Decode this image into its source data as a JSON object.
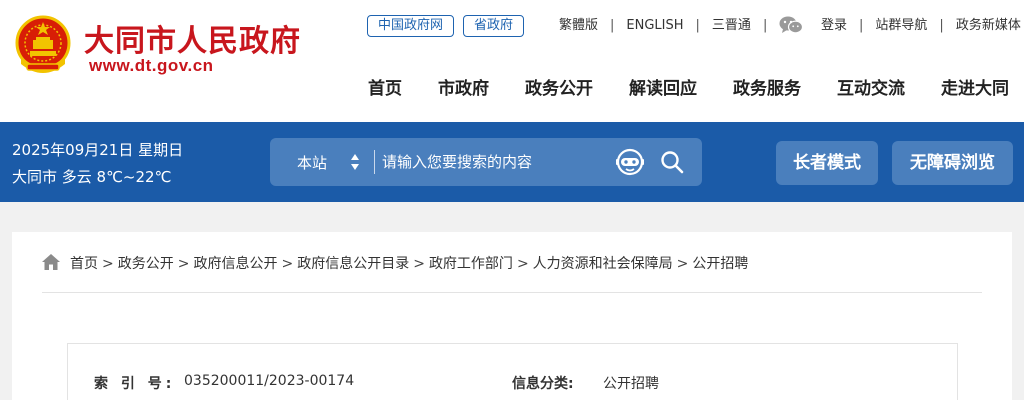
{
  "header": {
    "site_title": "大同市人民政府",
    "site_url": "www.dt.gov.cn",
    "portal_links": [
      "中国政府网",
      "省政府"
    ],
    "top_links_left": [
      "繁體版",
      "ENGLISH",
      "三晋通"
    ],
    "wechat_icon": "wechat-icon",
    "top_links_right": [
      "登录",
      "站群导航",
      "政务新媒体"
    ],
    "nav": [
      "首页",
      "市政府",
      "政务公开",
      "解读回应",
      "政务服务",
      "互动交流",
      "走进大同"
    ],
    "brand_color": "#c8161d"
  },
  "bluebar": {
    "date": "2025年09月21日 星期日",
    "weather": "大同市 多云 8℃~22℃",
    "search_scope": "本站",
    "search_placeholder": "请输入您要搜索的内容",
    "elder_mode": "长者模式",
    "accessible_mode": "无障碍浏览",
    "bar_color": "#1b5ba8"
  },
  "breadcrumb": [
    "首页",
    "政务公开",
    "政府信息公开",
    "政府信息公开目录",
    "政府工作部门",
    "人力资源和社会保障局",
    "公开招聘"
  ],
  "info": {
    "index_label": "索 引 号:",
    "index_value": "035200011/2023-00174",
    "category_label": "信息分类:",
    "category_value": "公开招聘"
  }
}
